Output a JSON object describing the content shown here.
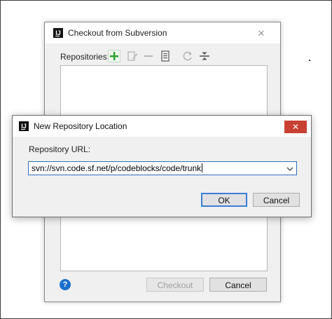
{
  "checkout_dialog": {
    "title": "Checkout from Subversion",
    "close_label": "✕",
    "repositories_label": "Repositories:",
    "toolbar_icons": [
      "add-icon",
      "edit-icon",
      "remove-icon",
      "browse-icon",
      "refresh-icon",
      "collapse-icon"
    ],
    "help_label": "?",
    "checkout_button": "Checkout",
    "cancel_button": "Cancel"
  },
  "new_repo_dialog": {
    "title": "New Repository Location",
    "close_label": "✕",
    "url_label": "Repository URL:",
    "url_value": "svn://svn.code.sf.net/p/codeblocks/code/trunk",
    "ok_button": "OK",
    "cancel_button": "Cancel"
  },
  "colors": {
    "accent": "#3d7ed6",
    "close_red": "#c84031",
    "add_green": "#2aa02a",
    "help_blue": "#1b6fcf"
  }
}
